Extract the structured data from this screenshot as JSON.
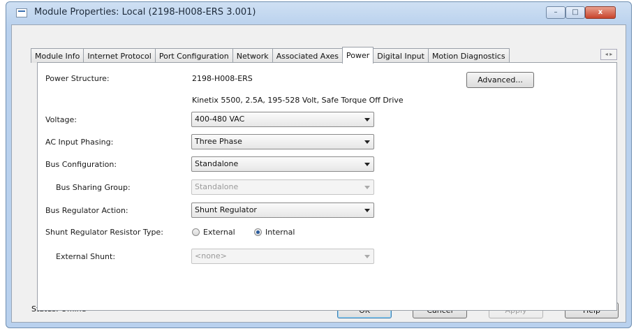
{
  "window": {
    "title": "Module Properties: Local (2198-H008-ERS 3.001)",
    "minimize_glyph": "–",
    "maximize_glyph": "□",
    "close_glyph": "x"
  },
  "tabs": [
    {
      "label": "Module Info",
      "active": false
    },
    {
      "label": "Internet Protocol",
      "active": false
    },
    {
      "label": "Port Configuration",
      "active": false
    },
    {
      "label": "Network",
      "active": false
    },
    {
      "label": "Associated Axes",
      "active": false
    },
    {
      "label": "Power",
      "active": true
    },
    {
      "label": "Digital Input",
      "active": false
    },
    {
      "label": "Motion Diagnostics",
      "active": false
    }
  ],
  "tab_scroll": "◂ ▸",
  "power": {
    "power_structure_label": "Power Structure:",
    "power_structure_value": "2198-H008-ERS",
    "power_structure_description": "Kinetix 5500, 2.5A, 195-528 Volt, Safe Torque Off Drive",
    "advanced_button": "Advanced...",
    "voltage_label": "Voltage:",
    "voltage_value": "400-480 VAC",
    "ac_phasing_label": "AC Input Phasing:",
    "ac_phasing_value": "Three Phase",
    "bus_config_label": "Bus Configuration:",
    "bus_config_value": "Standalone",
    "bus_sharing_label": "Bus Sharing Group:",
    "bus_sharing_value": "Standalone",
    "bus_regulator_label": "Bus Regulator Action:",
    "bus_regulator_value": "Shunt Regulator",
    "shunt_type_label": "Shunt Regulator Resistor Type:",
    "shunt_type_external": "External",
    "shunt_type_internal": "Internal",
    "shunt_type_selected": "Internal",
    "external_shunt_label": "External Shunt:",
    "external_shunt_value": "<none>"
  },
  "status": {
    "text": "Status:  Offline"
  },
  "buttons": {
    "ok": "OK",
    "cancel": "Cancel",
    "apply": "Apply",
    "help": "Help"
  }
}
